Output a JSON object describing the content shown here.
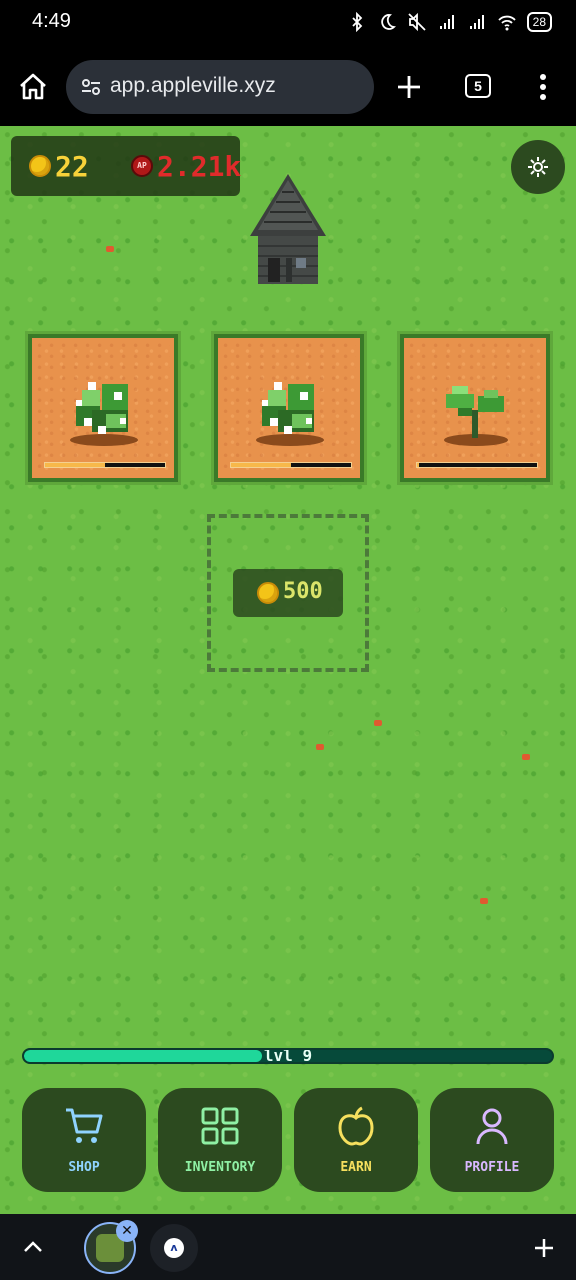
{
  "status_bar": {
    "time": "4:49",
    "battery": "28",
    "icons": [
      "signal-off-icon",
      "bluetooth-icon",
      "moon-icon",
      "mute-icon",
      "cell-signal-icon",
      "cell-signal-icon",
      "wifi-icon",
      "battery-icon"
    ]
  },
  "browser": {
    "url": "app.appleville.xyz",
    "tab_count": "5",
    "icons": [
      "home-icon",
      "site-settings-icon",
      "plus-icon",
      "tabs-icon",
      "more-menu-icon"
    ]
  },
  "game": {
    "coins": "22",
    "ap_label": "AP",
    "ap": "2.21k",
    "plots": [
      {
        "plant": "flowering-plant",
        "progress": 0.5
      },
      {
        "plant": "flowering-plant",
        "progress": 0.5
      },
      {
        "plant": "seedling",
        "progress": 0.02
      }
    ],
    "empty_plot_price": "500",
    "level": {
      "label": "lvl 9",
      "progress": 0.45
    },
    "nav": [
      {
        "label": "SHOP",
        "icon": "cart-icon",
        "color": "#8fd3ff"
      },
      {
        "label": "INVENTORY",
        "icon": "grid-icon",
        "color": "#8ff0a4"
      },
      {
        "label": "EARN",
        "icon": "apple-icon",
        "color": "#f6e05e"
      },
      {
        "label": "PROFILE",
        "icon": "user-icon",
        "color": "#d9b8ff"
      }
    ]
  },
  "colors": {
    "grass": "#6cbe45",
    "panel": "#2c4a1f",
    "coin": "#f7d23a",
    "ap": "#e02b2b",
    "level_fill": "#1fd79a"
  }
}
